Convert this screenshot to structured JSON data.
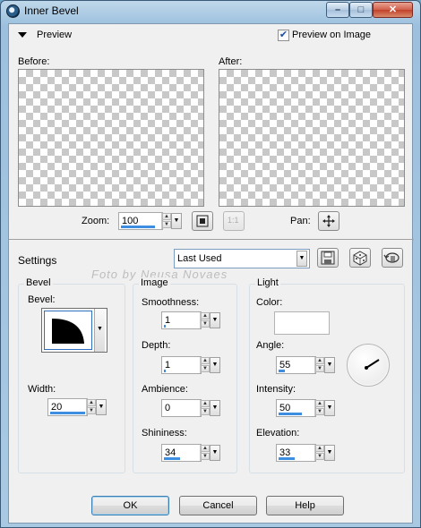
{
  "window": {
    "title": "Inner Bevel",
    "minimize": "–",
    "maximize": "□",
    "close": "✕"
  },
  "preview": {
    "section_label": "Preview",
    "preview_on_image_label": "Preview on Image",
    "preview_on_image_checked": true,
    "before_label": "Before:",
    "after_label": "After:",
    "zoom_label": "Zoom:",
    "zoom_value": "100",
    "pan_label": "Pan:",
    "one_to_one_label": "1:1"
  },
  "settings": {
    "label": "Settings",
    "preset_value": "Last Used"
  },
  "watermark": "Foto by Neusa Novaes",
  "bevel": {
    "title": "Bevel",
    "bevel_label": "Bevel:",
    "width_label": "Width:",
    "width_value": "20",
    "width_level": 0.2
  },
  "image": {
    "title": "Image",
    "smoothness_label": "Smoothness:",
    "smoothness_value": "1",
    "smoothness_level": 0.01,
    "depth_label": "Depth:",
    "depth_value": "1",
    "depth_level": 0.01,
    "ambience_label": "Ambience:",
    "ambience_value": "0",
    "ambience_level": 0.0,
    "shininess_label": "Shininess:",
    "shininess_value": "34",
    "shininess_level": 0.34
  },
  "light": {
    "title": "Light",
    "color_label": "Color:",
    "color_value": "#ffffff",
    "angle_label": "Angle:",
    "angle_value": "55",
    "angle_level": 0.15,
    "intensity_label": "Intensity:",
    "intensity_value": "50",
    "intensity_level": 0.5,
    "elevation_label": "Elevation:",
    "elevation_value": "33",
    "elevation_level": 0.37
  },
  "buttons": {
    "ok": "OK",
    "cancel": "Cancel",
    "help": "Help"
  },
  "colors": {
    "accent": "#3d8ee0",
    "default_border": "#3c7fb1"
  }
}
